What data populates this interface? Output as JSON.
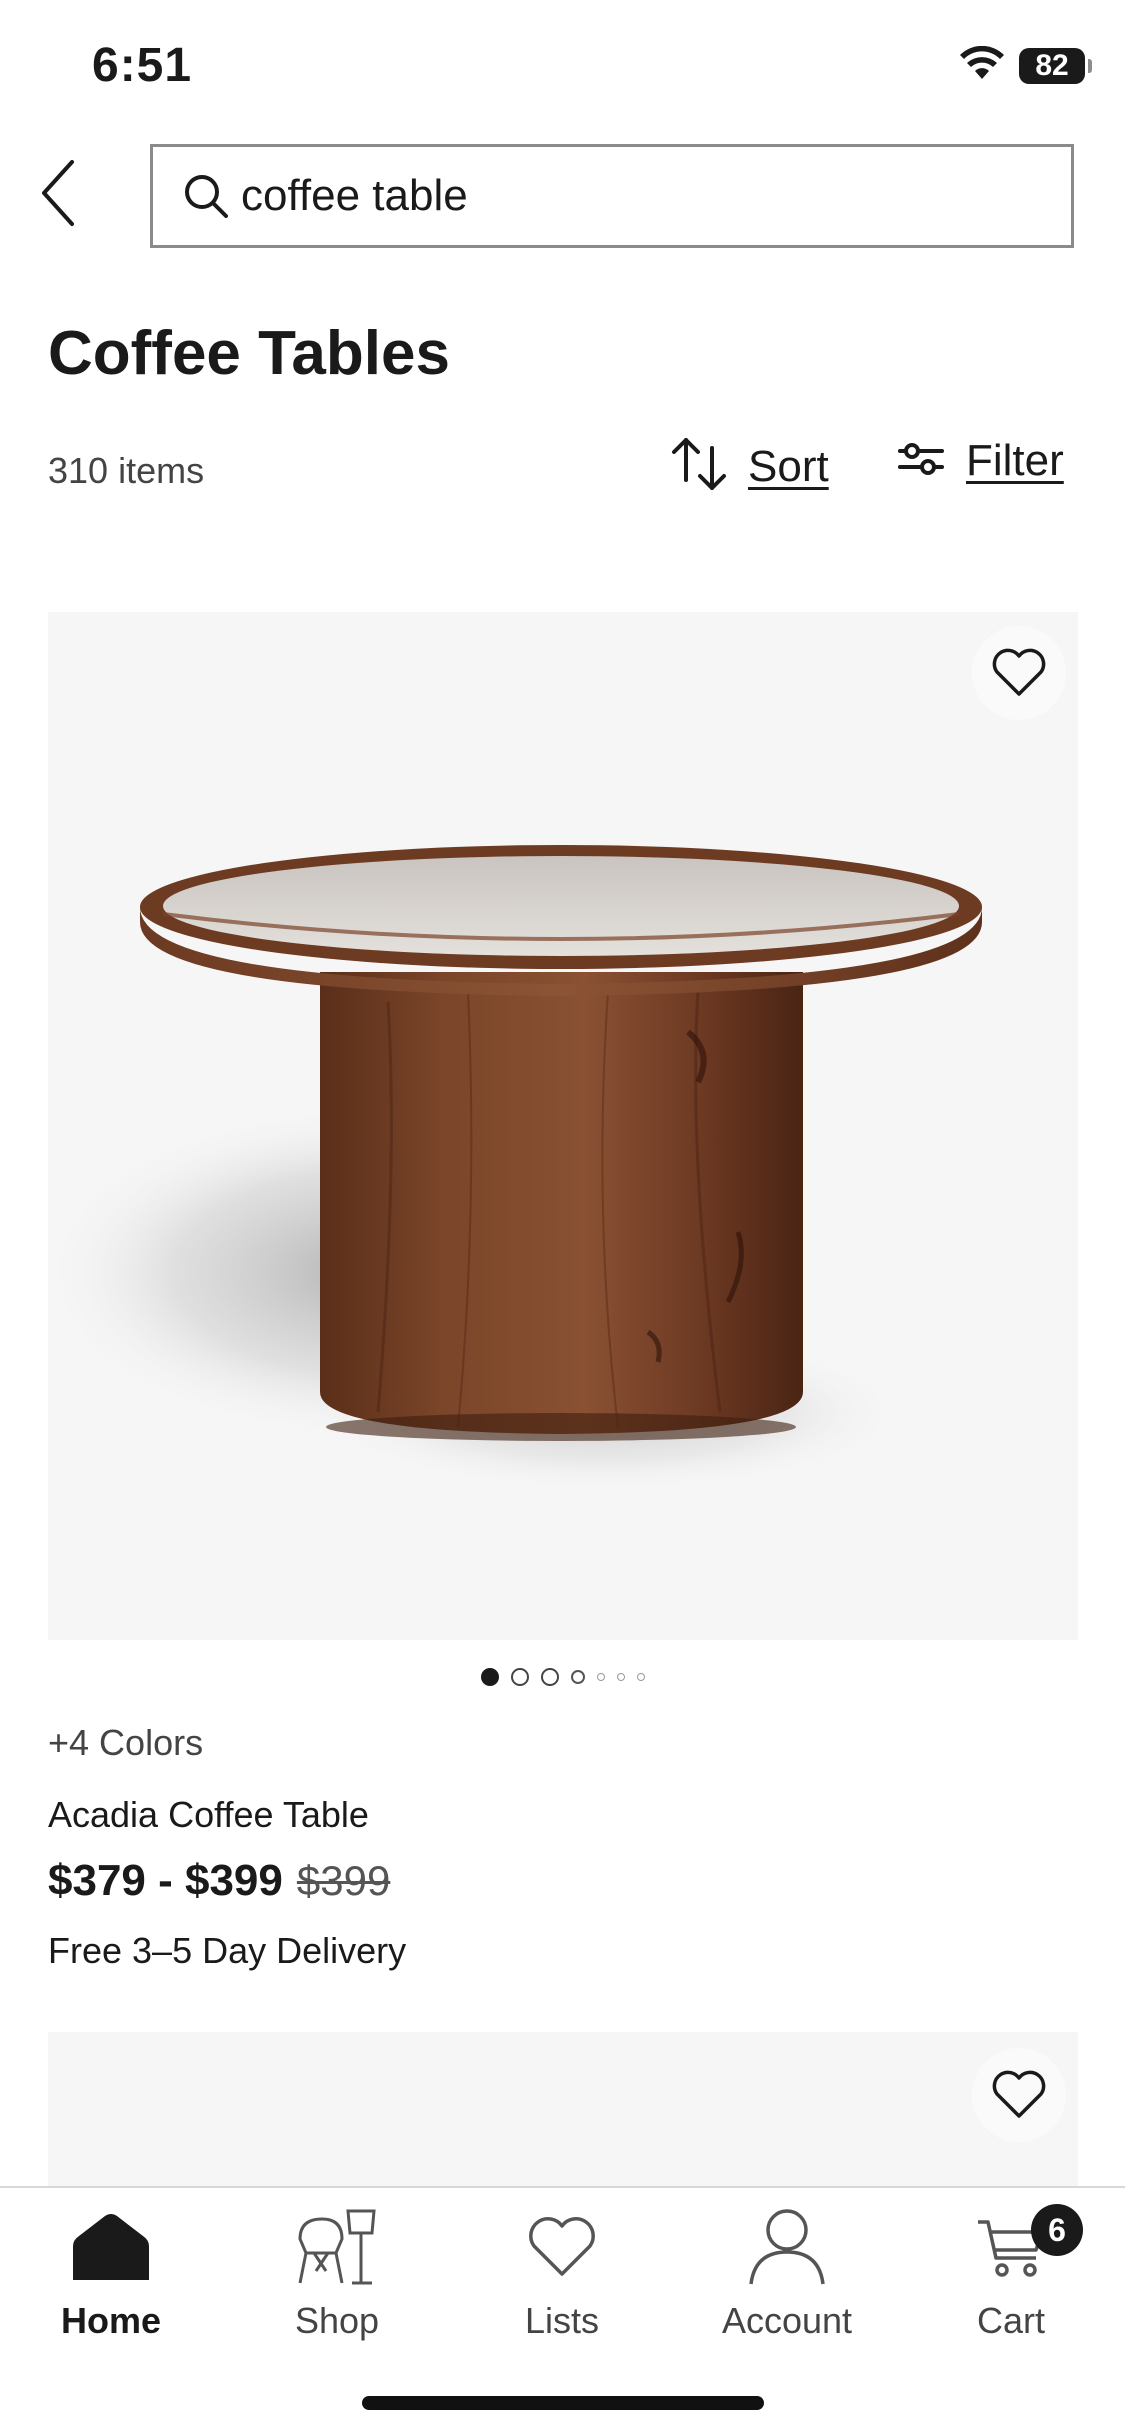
{
  "status_bar": {
    "time": "6:51",
    "battery": "82"
  },
  "search": {
    "value": "coffee table",
    "placeholder": ""
  },
  "header": {
    "title": "Coffee Tables",
    "item_count": "310 items",
    "sort_label": "Sort",
    "filter_label": "Filter"
  },
  "products": [
    {
      "colors": "+4 Colors",
      "name": "Acadia Coffee Table",
      "price": "$379 - $399",
      "original_price": "$399",
      "delivery": "Free 3–5 Day Delivery",
      "image_dots": {
        "total": 7,
        "active": 1
      }
    }
  ],
  "tab_bar": {
    "tabs": [
      {
        "label": "Home",
        "icon": "home-icon",
        "active": true
      },
      {
        "label": "Shop",
        "icon": "chair-lamp-icon",
        "active": false
      },
      {
        "label": "Lists",
        "icon": "heart-icon",
        "active": false
      },
      {
        "label": "Account",
        "icon": "person-icon",
        "active": false
      },
      {
        "label": "Cart",
        "icon": "cart-icon",
        "active": false
      }
    ],
    "cart_count": "6"
  },
  "colors": {
    "text": "#1a1a1a",
    "muted": "#444444",
    "image_bg": "#f6f6f6",
    "wood": "#6b3a22"
  }
}
